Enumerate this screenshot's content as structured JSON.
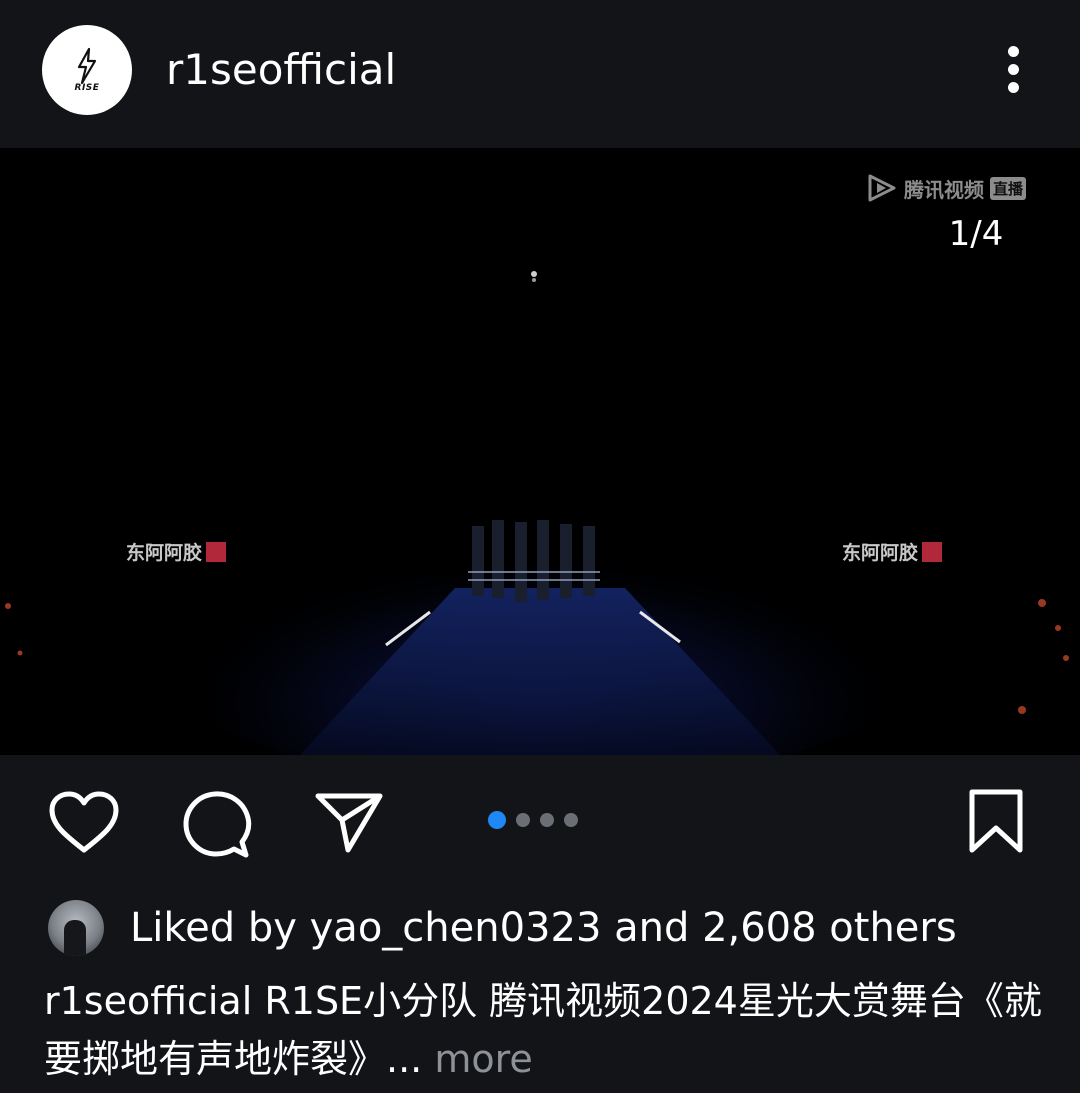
{
  "post": {
    "username": "r1seofficial",
    "avatar_logo_text": "RISE",
    "media_counter": "1/4",
    "watermark": {
      "brand": "腾讯视频",
      "tag": "直播"
    },
    "sponsor_text": "东阿阿胶",
    "carousel": {
      "total": 4,
      "active_index": 0
    },
    "likes": {
      "text": "Liked by yao_chen0323 and 2,608 others"
    },
    "caption": {
      "username": "r1seofficial",
      "text": "R1SE小分队 腾讯视频2024星光大赏舞台《就要掷地有声地炸裂》...",
      "more_label": "more"
    }
  },
  "icons": {
    "more": "more-vertical-icon",
    "like": "heart-icon",
    "comment": "comment-icon",
    "share": "send-icon",
    "save": "bookmark-icon"
  },
  "colors": {
    "background": "#121418",
    "text": "#ffffff",
    "muted": "#8e9196",
    "active_dot": "#1e88f5"
  }
}
